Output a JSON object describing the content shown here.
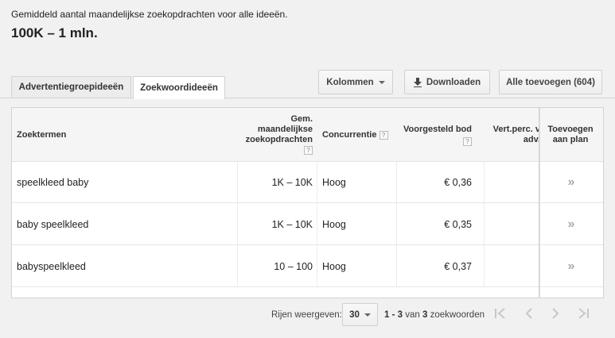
{
  "summary": {
    "label": "Gemiddeld aantal maandelijkse zoekopdrachten voor alle ideeën.",
    "value": "100K – 1 mln."
  },
  "tabs": [
    {
      "label": "Advertentiegroepideeën",
      "active": false
    },
    {
      "label": "Zoekwoordideeën",
      "active": true
    }
  ],
  "toolbar": {
    "columns_label": "Kolommen",
    "download_label": "Downloaden",
    "add_all_label": "Alle toevoegen (604)"
  },
  "table": {
    "headers": {
      "terms": "Zoektermen",
      "avg_line1": "Gem.",
      "avg_line2": "maandelijkse",
      "avg_line3": "zoekopdrachten",
      "competition": "Concurrentie",
      "bid": "Voorgesteld bod",
      "share_line1": "Vert.perc. v",
      "share_line2": "adv.",
      "addplan_line1": "Toevoegen",
      "addplan_line2": "aan plan",
      "help": "?"
    },
    "rows": [
      {
        "term": "speelkleed baby",
        "avg": "1K – 10K",
        "competition": "Hoog",
        "bid": "€ 0,36",
        "add": "»"
      },
      {
        "term": "baby speelkleed",
        "avg": "1K – 10K",
        "competition": "Hoog",
        "bid": "€ 0,35",
        "add": "»"
      },
      {
        "term": "babyspeelkleed",
        "avg": "10 – 100",
        "competition": "Hoog",
        "bid": "€ 0,37",
        "add": "»"
      }
    ]
  },
  "footer": {
    "rows_label": "Rijen weergeven:",
    "rows_value": "30",
    "range_prefix": "1 - 3",
    "range_mid": "van",
    "range_total": "3",
    "range_suffix": "zoekwoorden"
  },
  "icons": {
    "first_page": "first-page-icon",
    "prev_page": "prev-page-icon",
    "next_page": "next-page-icon",
    "last_page": "last-page-icon"
  }
}
